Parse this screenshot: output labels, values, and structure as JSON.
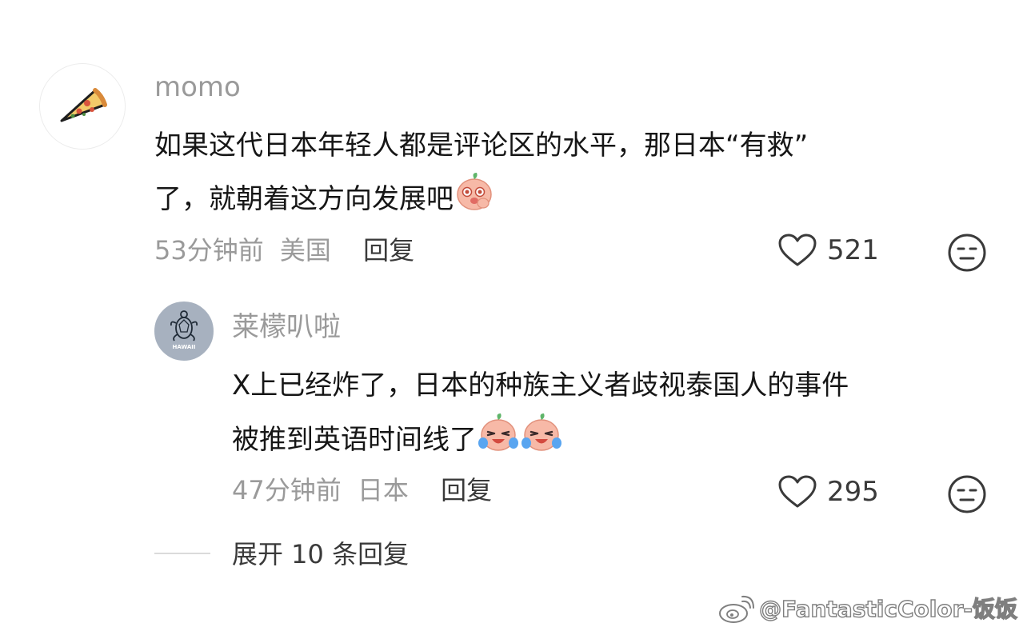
{
  "comment": {
    "username": "momo",
    "text_line1": "如果这代日本年轻人都是评论区的水平，那日本“有救”",
    "text_line2": "了，就朝着这方向发展吧",
    "time": "53分钟前",
    "location": "美国",
    "reply_label": "回复",
    "likes": "521",
    "avatar_icon": "pizza-slice-icon",
    "emoji_icon": "peach-blush-emoji-icon"
  },
  "reply": {
    "username": "莱檬叭啦",
    "text_line1": "X上已经炸了，日本的种族主义者歧视泰国人的事件",
    "text_line2": "被推到英语时间线了",
    "time": "47分钟前",
    "location": "日本",
    "reply_label": "回复",
    "likes": "295",
    "avatar_icon": "turtle-hawaii-icon",
    "avatar_text": "HAWAII",
    "emoji_icon": "peach-crying-emoji-icon"
  },
  "expand": {
    "label": "展开 10 条回复"
  },
  "watermark": {
    "text": "@FantasticColor-饭饭",
    "icon": "weibo-logo-icon"
  },
  "colors": {
    "username": "#9a9a9a",
    "text": "#161616",
    "meta": "#9a9a9a",
    "action": "#3a3a3a",
    "reply_avatar_bg": "#a7b1bf"
  }
}
